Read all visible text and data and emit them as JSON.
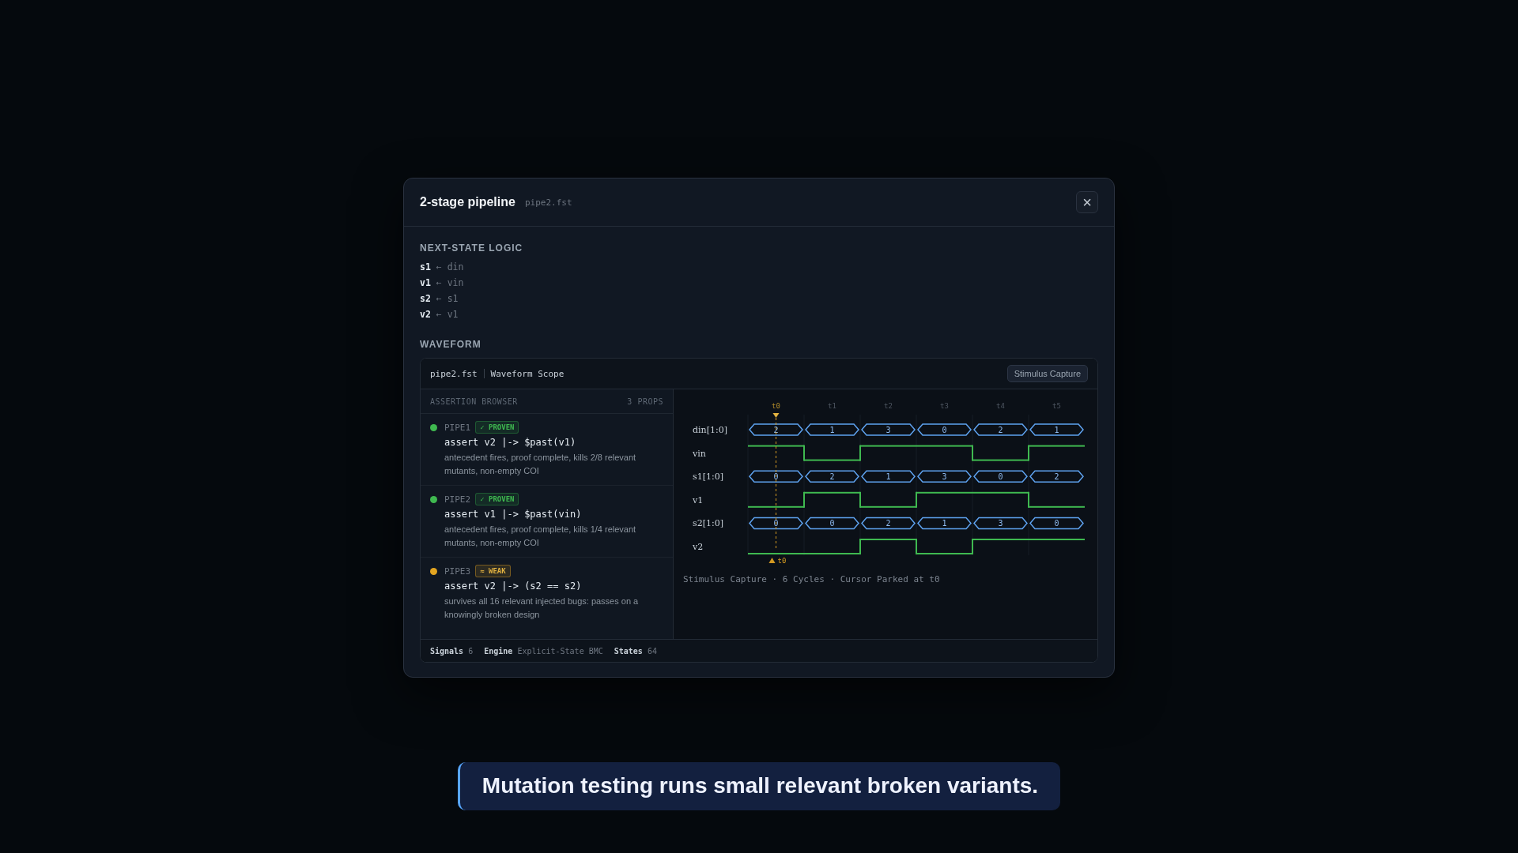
{
  "modal": {
    "title": "2-stage pipeline",
    "file": "pipe2.fst",
    "close": "×"
  },
  "logic": {
    "heading": "NEXT-STATE LOGIC",
    "rules": [
      {
        "target": "s1",
        "arrow": "←",
        "source": "din"
      },
      {
        "target": "v1",
        "arrow": "←",
        "source": "vin"
      },
      {
        "target": "s2",
        "arrow": "←",
        "source": "s1"
      },
      {
        "target": "v2",
        "arrow": "←",
        "source": "v1"
      }
    ]
  },
  "waveform": {
    "heading": "WAVEFORM",
    "file": "pipe2.fst",
    "scope": "Waveform Scope",
    "capture_button": "Stimulus Capture",
    "browser": {
      "title": "ASSERTION BROWSER",
      "count": "3 PROPS",
      "assertions": [
        {
          "id": "PIPE1",
          "kind": "proven",
          "badge": "✓ PROVEN",
          "code": "assert v2 |-> $past(v1)",
          "note": "antecedent fires, proof complete, kills 2/8 relevant mutants, non-empty COI"
        },
        {
          "id": "PIPE2",
          "kind": "proven",
          "badge": "✓ PROVEN",
          "code": "assert v1 |-> $past(vin)",
          "note": "antecedent fires, proof complete, kills 1/4 relevant mutants, non-empty COI"
        },
        {
          "id": "PIPE3",
          "kind": "weak",
          "badge": "≈ WEAK",
          "code": "assert v2 |-> (s2 == s2)",
          "note": "survives all 16 relevant injected bugs: passes on a knowingly broken design"
        }
      ]
    },
    "ticks": [
      {
        "label": "t0",
        "selected": true
      },
      {
        "label": "t1",
        "selected": false
      },
      {
        "label": "t2",
        "selected": false
      },
      {
        "label": "t3",
        "selected": false
      },
      {
        "label": "t4",
        "selected": false
      },
      {
        "label": "t5",
        "selected": false
      }
    ],
    "signals": [
      {
        "name": "din[1:0]",
        "kind": "bus",
        "values": [
          "2",
          "1",
          "3",
          "0",
          "2",
          "1"
        ]
      },
      {
        "name": "vin",
        "kind": "bit",
        "high": [
          true,
          false,
          true,
          true,
          false,
          true
        ]
      },
      {
        "name": "s1[1:0]",
        "kind": "bus",
        "values": [
          "0",
          "2",
          "1",
          "3",
          "0",
          "2"
        ]
      },
      {
        "name": "v1",
        "kind": "bit",
        "high": [
          false,
          true,
          false,
          true,
          true,
          false
        ]
      },
      {
        "name": "s2[1:0]",
        "kind": "bus",
        "values": [
          "0",
          "0",
          "2",
          "1",
          "3",
          "0"
        ]
      },
      {
        "name": "v2",
        "kind": "bit",
        "high": [
          false,
          false,
          true,
          false,
          true,
          true
        ]
      }
    ],
    "cursor_label": "t0",
    "caption": "Stimulus Capture · 6 Cycles · Cursor Parked at t0",
    "stats": [
      {
        "label": "Signals",
        "value": "6"
      },
      {
        "label": "Engine",
        "value": "Explicit-State BMC"
      },
      {
        "label": "States",
        "value": "64"
      }
    ]
  },
  "toast": "Mutation testing runs small relevant broken variants."
}
